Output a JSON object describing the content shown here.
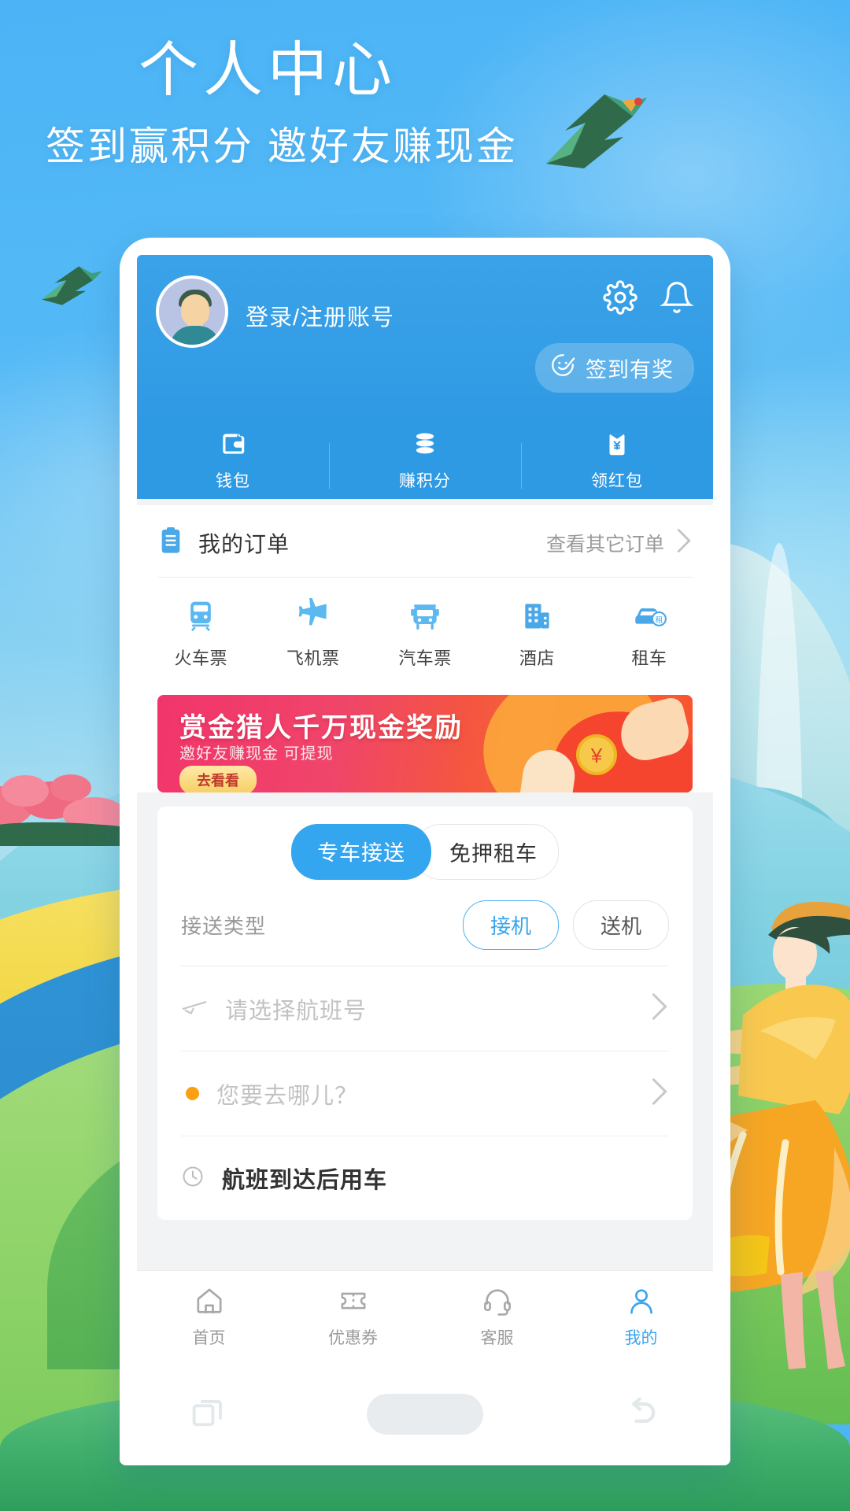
{
  "hero": {
    "title": "个人中心",
    "subtitle": "签到赢积分  邀好友赚现金"
  },
  "phone": {
    "profile": {
      "avatar_icon": "user-avatar",
      "login_label": "登录/注册账号",
      "gear_icon": "gear-icon",
      "bell_icon": "bell-icon",
      "signin_icon": "smiley-check-icon",
      "signin_label": "签到有奖"
    },
    "wallet_tabs": [
      {
        "icon": "wallet-icon",
        "label": "钱包"
      },
      {
        "icon": "coins-icon",
        "label": "赚积分"
      },
      {
        "icon": "red-packet-icon",
        "label": "领红包"
      }
    ],
    "orders": {
      "icon": "clipboard-icon",
      "title": "我的订单",
      "more_label": "查看其它订单",
      "chevron_icon": "chevron-right-icon"
    },
    "services": [
      {
        "icon": "train-icon",
        "label": "火车票"
      },
      {
        "icon": "airplane-icon",
        "label": "飞机票"
      },
      {
        "icon": "bus-icon",
        "label": "汽车票"
      },
      {
        "icon": "hotel-icon",
        "label": "酒店"
      },
      {
        "icon": "car-rental-icon",
        "label": "租车"
      }
    ],
    "banner": {
      "title": "赏金猎人千万现金奖励",
      "subtitle": "邀好友赚现金 可提现",
      "button_label": "去看看",
      "coin_symbol": "¥"
    },
    "booking": {
      "segments": [
        {
          "label": "专车接送",
          "active": true
        },
        {
          "label": "免押租车",
          "active": false
        }
      ],
      "type_label": "接送类型",
      "type_options": [
        {
          "label": "接机",
          "selected": true
        },
        {
          "label": "送机",
          "selected": false
        }
      ],
      "fields": [
        {
          "icon": "airplane-small-icon",
          "placeholder": "请选择航班号",
          "chevron": "chevron-right-icon"
        },
        {
          "icon": "location-dot-icon",
          "placeholder": "您要去哪儿？",
          "chevron": "chevron-right-icon"
        },
        {
          "icon": "clock-icon",
          "value": "航班到达后用车",
          "chevron": ""
        }
      ]
    },
    "tabbar": [
      {
        "icon": "home-icon",
        "label": "首页",
        "active": false
      },
      {
        "icon": "coupon-icon",
        "label": "优惠券",
        "active": false
      },
      {
        "icon": "headset-icon",
        "label": "客服",
        "active": false
      },
      {
        "icon": "person-icon",
        "label": "我的",
        "active": true
      }
    ],
    "navbar": [
      {
        "icon": "recents-icon"
      },
      {
        "icon": "home-pill-icon"
      },
      {
        "icon": "back-icon"
      }
    ]
  },
  "colors": {
    "brand_blue": "#3aa5ee",
    "header_blue": "#2f9ae4",
    "accent_orange": "#fba012",
    "banner_red": "#f1356b"
  }
}
